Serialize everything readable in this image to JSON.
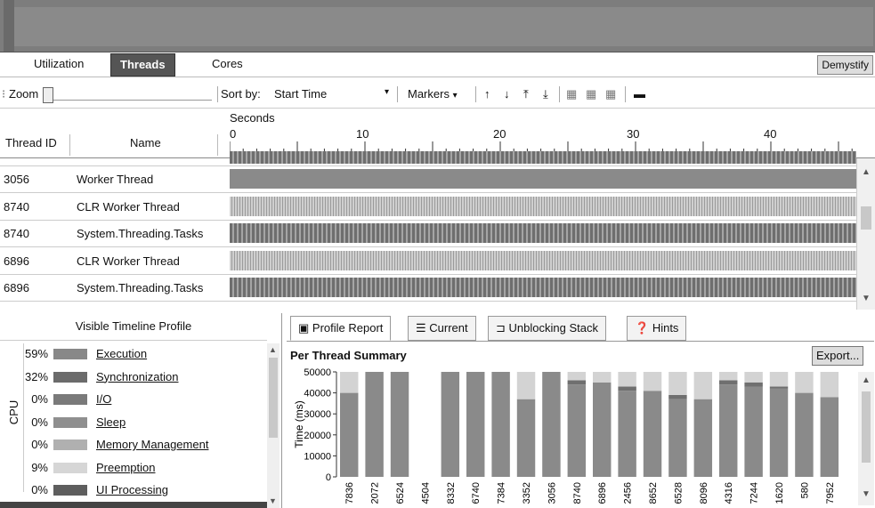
{
  "view_tabs": {
    "tabs": [
      "Utilization",
      "Threads",
      "Cores"
    ],
    "active": "Threads",
    "demystify_label": "Demystify"
  },
  "toolbar": {
    "zoom_label": "Zoom",
    "sort_by_label": "Sort by:",
    "sort_by_value": "Start Time",
    "markers_label": "Markers"
  },
  "ruler": {
    "seconds_label": "Seconds",
    "ticks": [
      "0",
      "10",
      "20",
      "30",
      "40"
    ]
  },
  "thread_table": {
    "col_thread_id": "Thread ID",
    "col_name": "Name",
    "rows": [
      {
        "id": "3056",
        "name": "Worker Thread",
        "style": "solid"
      },
      {
        "id": "8740",
        "name": "CLR Worker Thread",
        "style": "thin"
      },
      {
        "id": "8740",
        "name": "System.Threading.Tasks",
        "style": "hatch"
      },
      {
        "id": "6896",
        "name": "CLR Worker Thread",
        "style": "thin"
      },
      {
        "id": "6896",
        "name": "System.Threading.Tasks",
        "style": "hatch"
      }
    ]
  },
  "legend": {
    "title": "Visible Timeline Profile",
    "group_label": "CPU",
    "items": [
      {
        "pct": "59%",
        "label": "Execution",
        "color": "#888888"
      },
      {
        "pct": "32%",
        "label": "Synchronization",
        "color": "#6b6b6b"
      },
      {
        "pct": "0%",
        "label": "I/O",
        "color": "#7a7a7a"
      },
      {
        "pct": "0%",
        "label": "Sleep",
        "color": "#8f8f8f"
      },
      {
        "pct": "0%",
        "label": "Memory Management",
        "color": "#b0b0b0"
      },
      {
        "pct": "9%",
        "label": "Preemption",
        "color": "#d6d6d6"
      },
      {
        "pct": "0%",
        "label": "UI Processing",
        "color": "#5e5e5e"
      }
    ]
  },
  "report_tabs": {
    "tabs": [
      "Profile Report",
      "Current",
      "Unblocking Stack",
      "Hints"
    ],
    "active": "Profile Report"
  },
  "report": {
    "title": "Per Thread Summary",
    "export_label": "Export..."
  },
  "chart_data": {
    "type": "bar",
    "ylabel": "Time (ms)",
    "ylim": [
      0,
      50000
    ],
    "yticks": [
      "0",
      "10000",
      "20000",
      "30000",
      "40000",
      "50000"
    ],
    "categories": [
      "7836",
      "2072",
      "6524",
      "4504",
      "8332",
      "6740",
      "7384",
      "3352",
      "3056",
      "8740",
      "6896",
      "2456",
      "8652",
      "6528",
      "8096",
      "4316",
      "7244",
      "1620",
      "580",
      "7952"
    ],
    "series": [
      {
        "values": [
          40000,
          50000,
          50000,
          0,
          50000,
          50000,
          50000,
          37000,
          50000,
          44000,
          45000,
          41000,
          41000,
          37000,
          37000,
          44000,
          43000,
          42000,
          40000,
          38000
        ]
      },
      {
        "values": [
          0,
          0,
          0,
          0,
          0,
          0,
          0,
          0,
          0,
          2000,
          0,
          2000,
          0,
          2000,
          0,
          2000,
          2000,
          1000,
          0,
          0
        ]
      },
      {
        "values": [
          10000,
          0,
          0,
          0,
          0,
          0,
          0,
          13000,
          0,
          4000,
          5000,
          7000,
          9000,
          11000,
          13000,
          4000,
          5000,
          7000,
          10000,
          12000
        ]
      }
    ],
    "colors": [
      "#8a8a8a",
      "#6f6f6f",
      "#d3d3d3"
    ]
  }
}
